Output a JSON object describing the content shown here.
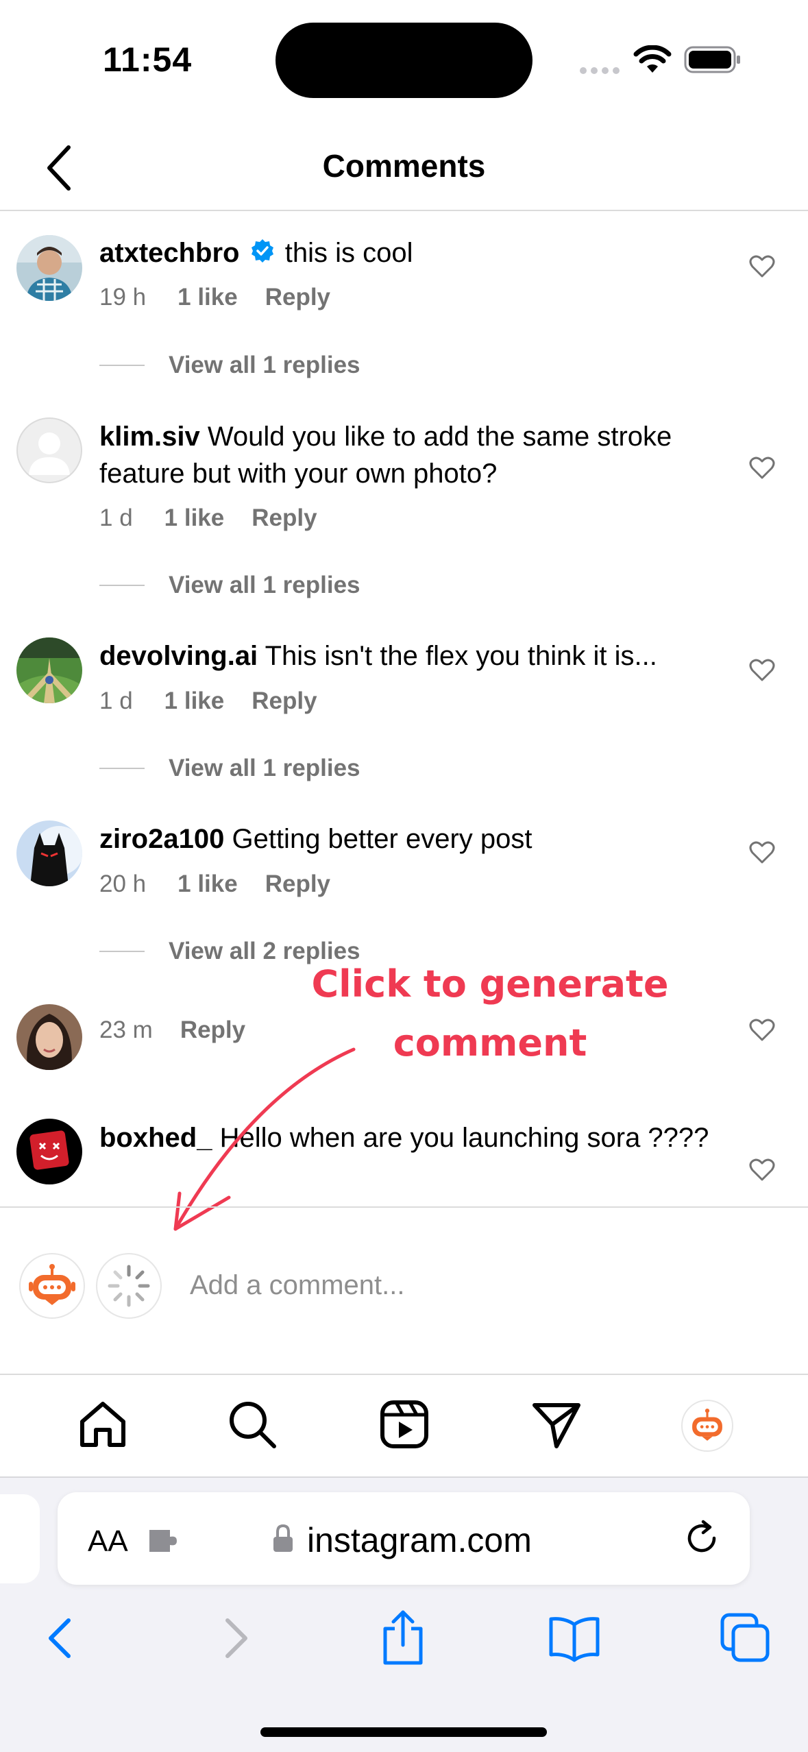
{
  "status": {
    "time": "11:54"
  },
  "header": {
    "title": "Comments"
  },
  "comments": [
    {
      "username": "atxtechbro",
      "verified": true,
      "text": "this is cool",
      "age": "19 h",
      "likes": "1 like",
      "reply": "Reply",
      "replies": "View all 1 replies"
    },
    {
      "username": "klim.siv",
      "text": "Would you like to add the same stroke feature but with your own photo?",
      "age": "1 d",
      "likes": "1 like",
      "reply": "Reply",
      "replies": "View all 1 replies"
    },
    {
      "username": "devolving.ai",
      "text": "This isn't the flex you think it is...",
      "age": "1 d",
      "likes": "1 like",
      "reply": "Reply",
      "replies": "View all 1 replies"
    },
    {
      "username": "ziro2a100",
      "text": "Getting better every post",
      "age": "20 h",
      "likes": "1 like",
      "reply": "Reply",
      "replies": "View all 2 replies"
    },
    {
      "username": "",
      "text": "",
      "age": "23 m",
      "reply": "Reply"
    },
    {
      "username": "boxhed_",
      "text": "Hello when are you launching sora ????"
    }
  ],
  "annotation": {
    "line1": "Click to generate",
    "line2": "comment"
  },
  "composer": {
    "placeholder": "Add a comment..."
  },
  "nav": [
    "home-icon",
    "search-icon",
    "reels-icon",
    "direct-message-icon",
    "profile-robot-icon"
  ],
  "safari": {
    "text_size": "AA",
    "url": "instagram.com"
  },
  "colors": {
    "annotation": "#ef3a52",
    "verified": "#0095f6",
    "safari_blue": "#007aff",
    "robot": "#f26b2c"
  }
}
